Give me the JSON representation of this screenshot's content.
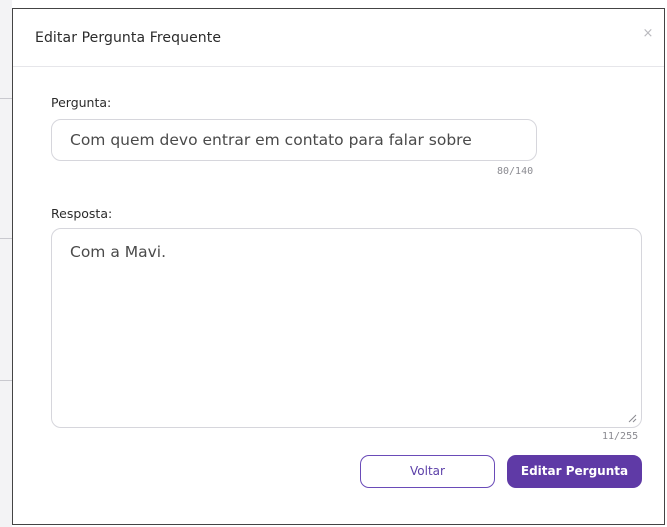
{
  "modal": {
    "title": "Editar Pergunta Frequente",
    "close_symbol": "×"
  },
  "question": {
    "label": "Pergunta:",
    "value": "Com quem devo entrar em contato para falar sobre",
    "counter": "80/140"
  },
  "answer": {
    "label": "Resposta:",
    "value": "Com a Mavi.",
    "counter": "11/255"
  },
  "buttons": {
    "back_label": "Voltar",
    "submit_label": "Editar Pergunta"
  },
  "colors": {
    "accent": "#5f3aa6",
    "border": "#d6d6dc"
  }
}
